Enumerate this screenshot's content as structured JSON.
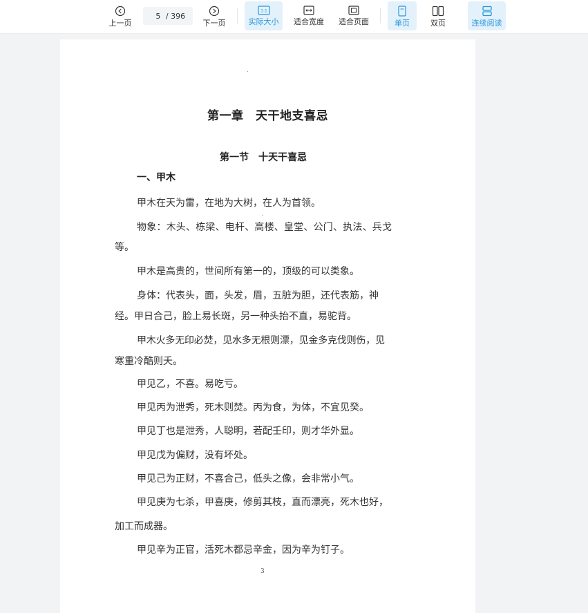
{
  "toolbar": {
    "prev_label": "上一页",
    "next_label": "下一页",
    "current_page": "5",
    "total_pages": "/ 396",
    "actual_size_label": "实际大小",
    "actual_size_icon_text": "1:1",
    "fit_width_label": "适合宽度",
    "fit_page_label": "适合页面",
    "single_page_label": "单页",
    "double_page_label": "双页",
    "continuous_label": "连续阅读",
    "accent_color": "#2a97d8",
    "active_bg": "#e3f1fb"
  },
  "document": {
    "chapter_title": "第一章　天干地支喜忌",
    "section_title": "第一节　十天干喜忌",
    "sub_title": "一、甲木",
    "lines": [
      "甲木在天为雷，在地为大树，在人为首领。",
      "物象：木头、栋梁、电杆、高楼、皇堂、公门、执法、兵戈",
      "等。",
      "甲木是高贵的，世间所有第一的，顶级的可以类象。",
      "身体：代表头，面，头发，眉，五脏为胆，还代表筋，神",
      "经。甲日合己，脸上易长斑，另一种头抬不直，易驼背。",
      "甲木火多无印必焚，见水多无根则漂，见金多克伐则伤，见",
      "寒重冷酷则夭。",
      "甲见乙，不喜。易吃亏。",
      "甲见丙为泄秀，死木则焚。丙为食，为体，不宜见癸。",
      "甲见丁也是泄秀，人聪明，若配壬印，则才华外显。",
      "甲见戊为偏财，没有坏处。",
      "甲见己为正财，不喜合己，低头之像，会非常小气。",
      "甲见庚为七杀，甲喜庚，修剪其枝，直而漂亮，死木也好，",
      "加工而成器。",
      "甲见辛为正官，活死木都忌辛金，因为辛为钉子。"
    ],
    "page_number": "3"
  }
}
